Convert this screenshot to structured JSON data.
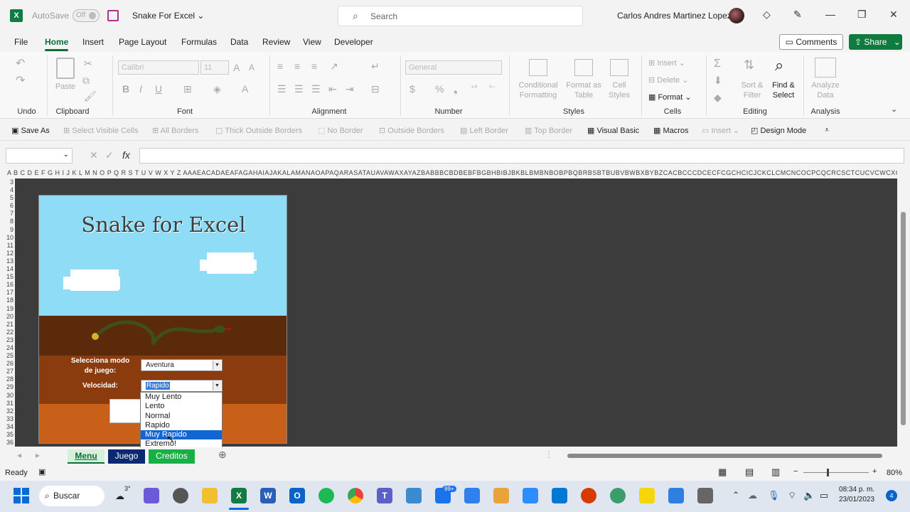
{
  "window": {
    "autosave_label": "AutoSave",
    "autosave_state": "Off",
    "title": "Snake For Excel",
    "search_placeholder": "Search",
    "user_name": "Carlos Andres Martinez Lopez"
  },
  "menu": {
    "items": [
      "File",
      "Home",
      "Insert",
      "Page Layout",
      "Formulas",
      "Data",
      "Review",
      "View",
      "Developer"
    ],
    "active": "Home",
    "comments_label": "Comments",
    "share_label": "Share"
  },
  "ribbon": {
    "groups": {
      "undo": "Undo",
      "clipboard": "Clipboard",
      "font": "Font",
      "alignment": "Alignment",
      "number": "Number",
      "styles": "Styles",
      "cells": "Cells",
      "editing": "Editing",
      "analysis": "Analysis"
    },
    "paste": "Paste",
    "font_name": "Calibri",
    "font_size": "11",
    "number_format": "General",
    "conditional_formatting": "Conditional Formatting",
    "format_as_table": "Format as Table",
    "cell_styles": "Cell Styles",
    "insert": "Insert",
    "delete": "Delete",
    "format": "Format",
    "sort_filter": "Sort & Filter",
    "find_select": "Find & Select",
    "analyze_data": "Analyze Data"
  },
  "qat": {
    "items": [
      "Save As",
      "Select Visible Cells",
      "All Borders",
      "Thick Outside Borders",
      "No Border",
      "Outside Borders",
      "Left Border",
      "Top Border",
      "Visual Basic",
      "Macros",
      "Insert",
      "Design Mode"
    ]
  },
  "sheet": {
    "column_headers": "A B C D E F G H I J K L M N O P Q R S T U V W X Y Z AAAEACADAEAFAGAHAIAJAKALAMANAOAPAQARASATAUAVAWAXAYAZBABBBCBDBEBFBGBHBIBJBKBLBMBNBOBPBQBRBSBTBUBVBWBXBYBZCACBCCCDCECFCGCHCICJCKCLCMCNCOCPCQCRCSCTCUCVCWCXCYCZDADBDCDDDE",
    "row_numbers": [
      "3",
      "4",
      "5",
      "6",
      "7",
      "8",
      "9",
      "10",
      "11",
      "12",
      "13",
      "14",
      "15",
      "16",
      "17",
      "18",
      "19",
      "20",
      "21",
      "22",
      "23",
      "24",
      "25",
      "26",
      "27",
      "28",
      "29",
      "30",
      "31",
      "32",
      "33",
      "34",
      "35",
      "36"
    ]
  },
  "game": {
    "title": "Snake for Excel",
    "mode_label": "Selecciona modo de juego:",
    "mode_value": "Aventura",
    "speed_label": "Velocidad:",
    "speed_value": "Rapido",
    "speed_options": [
      "Muy Lento",
      "Lento",
      "Normal",
      "Rapido",
      "Muy Rapido",
      "Extremo!"
    ],
    "highlighted_option": "Muy Rapido"
  },
  "tabs": [
    "Menu",
    "Juego",
    "Creditos"
  ],
  "status": {
    "ready": "Ready",
    "zoom": "80%"
  },
  "taskbar": {
    "search_label": "Buscar",
    "weather": "3°",
    "badge": "99+",
    "time": "08:34 p. m.",
    "date": "23/01/2023",
    "notifications": "4"
  }
}
